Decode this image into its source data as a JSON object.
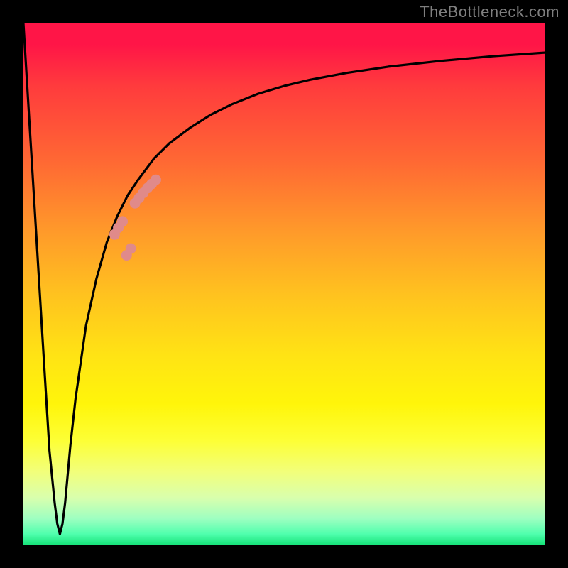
{
  "source_label": "TheBottleneck.com",
  "colors": {
    "frame": "#000000",
    "curve": "#000000",
    "dot_fill": "#e08a8a",
    "label": "#7f7f7f"
  },
  "chart_data": {
    "type": "line",
    "title": "",
    "xlabel": "",
    "ylabel": "",
    "xlim": [
      0,
      100
    ],
    "ylim": [
      0,
      100
    ],
    "note": "y-axis is inverted visually (0 at top, 100 at bottom). Curve values estimated from pixels.",
    "series": [
      {
        "name": "bottleneck-curve",
        "x": [
          0,
          2,
          4,
          5,
          6,
          6.5,
          7,
          7.5,
          8,
          9,
          10,
          12,
          14,
          16,
          18,
          20,
          22,
          25,
          28,
          32,
          36,
          40,
          45,
          50,
          55,
          62,
          70,
          80,
          90,
          100
        ],
        "y": [
          0,
          33,
          66,
          82,
          92,
          96,
          98,
          96,
          92,
          81,
          72,
          58,
          49,
          42,
          37,
          33,
          30,
          26,
          23,
          20,
          17.5,
          15.5,
          13.5,
          12,
          10.8,
          9.5,
          8.3,
          7.2,
          6.3,
          5.6
        ]
      }
    ],
    "scatter": {
      "name": "highlight-dots",
      "x": [
        17.5,
        18.2,
        19.0,
        19.8,
        20.6,
        21.4,
        22.2,
        23.0,
        23.8,
        24.6,
        25.4
      ],
      "y": [
        40.5,
        39.2,
        38.0,
        44.5,
        43.2,
        34.5,
        33.5,
        32.5,
        31.6,
        30.8,
        30.0
      ]
    }
  }
}
